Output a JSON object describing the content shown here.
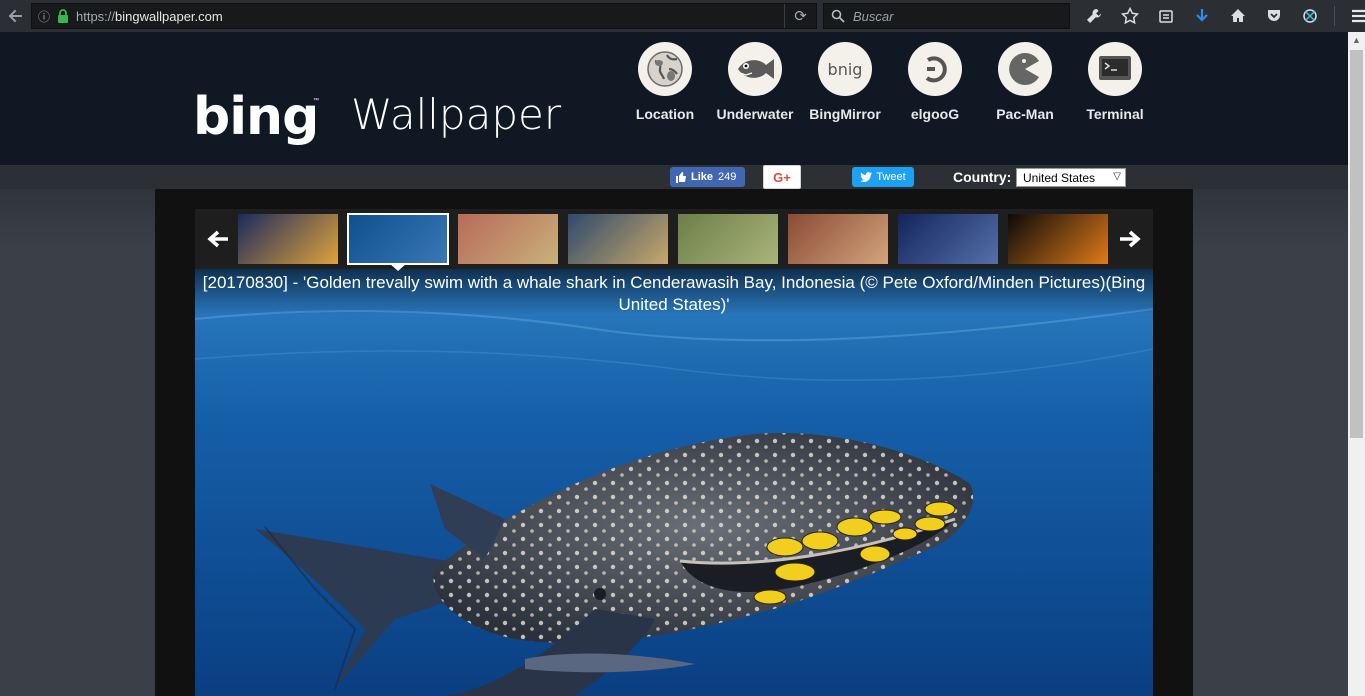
{
  "browser": {
    "url_scheme": "https://",
    "url_host": "bingwallpaper.com",
    "search_placeholder": "Buscar"
  },
  "header": {
    "logo_text": "bing",
    "logo_tm": "™",
    "site_title": "Wallpaper",
    "nav": [
      {
        "label": "Location",
        "icon": "globe-icon"
      },
      {
        "label": "Underwater",
        "icon": "fish-icon"
      },
      {
        "label": "BingMirror",
        "icon": "mirror-text-icon",
        "icon_text": "bnig"
      },
      {
        "label": "elgooG",
        "icon": "reverse-g-icon"
      },
      {
        "label": "Pac-Man",
        "icon": "pacman-icon"
      },
      {
        "label": "Terminal",
        "icon": "terminal-icon"
      }
    ]
  },
  "share": {
    "fb_like_label": "Like",
    "fb_like_count": "249",
    "gplus_label": "G+",
    "tweet_label": "Tweet",
    "country_label": "Country:",
    "country_value": "United States"
  },
  "gallery": {
    "thumbnails": [
      {
        "name": "night-coast-thumb",
        "colors": [
          "#1b2a5c",
          "#e0a33b"
        ]
      },
      {
        "name": "whale-shark-thumb",
        "colors": [
          "#0f4f8f",
          "#3a78b5"
        ],
        "active": true
      },
      {
        "name": "painted-hills-thumb",
        "colors": [
          "#b86a5a",
          "#c9b17a"
        ]
      },
      {
        "name": "sea-cliff-thumb",
        "colors": [
          "#2e4a6c",
          "#c8a86a"
        ]
      },
      {
        "name": "grass-thumb",
        "colors": [
          "#6c7f48",
          "#aab47a"
        ]
      },
      {
        "name": "lemur-thumb",
        "colors": [
          "#8a4b35",
          "#d3a47c"
        ]
      },
      {
        "name": "night-village-thumb",
        "colors": [
          "#12255a",
          "#5570a8"
        ]
      },
      {
        "name": "firework-thumb",
        "colors": [
          "#0a0a0a",
          "#e07a1a"
        ]
      }
    ],
    "caption": "[20170830] - 'Golden trevally swim with a whale shark in Cenderawasih Bay, Indonesia (© Pete Oxford/Minden Pictures)(Bing United States)'"
  },
  "colors": {
    "header_bg": "#0f1823",
    "fb_blue": "#4267b2",
    "twitter_blue": "#1da1f2",
    "gplus_red": "#dd4b39"
  }
}
